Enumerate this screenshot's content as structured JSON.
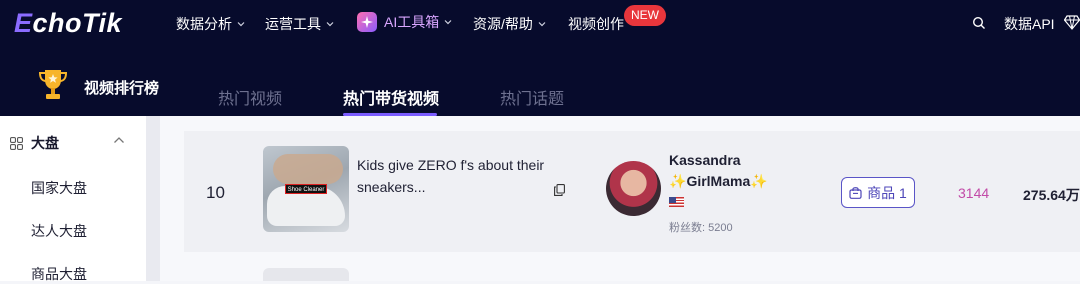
{
  "app": {
    "logo": "EchoTik"
  },
  "nav": {
    "items": [
      {
        "label": "数据分析"
      },
      {
        "label": "运营工具"
      },
      {
        "label": "AI工具箱"
      },
      {
        "label": "资源/帮助"
      },
      {
        "label": "视频创作",
        "badge": "NEW"
      }
    ],
    "data_api": "数据API"
  },
  "ranking": {
    "title": "视频排行榜",
    "tabs": [
      "热门视频",
      "热门带货视频",
      "热门话题"
    ],
    "active_tab": "热门带货视频"
  },
  "sidebar": {
    "section": "大盘",
    "items": [
      "国家大盘",
      "达人大盘",
      "商品大盘"
    ]
  },
  "row": {
    "rank": "10",
    "thumb_label": "Shoe Cleaner",
    "title": "Kids give ZERO f's about their sneakers...",
    "creator_name": "Kassandra",
    "creator_handle": "GirlMama",
    "spark": "✨",
    "followers": "粉丝数: 5200",
    "goods_button": "商品 1",
    "metric_a": "3144",
    "metric_b": "275.64万"
  },
  "colors": {
    "nav_bg": "#070b2c",
    "accent": "#7b5cff",
    "badge": "#e8363c",
    "metric_pink": "#c24ba8"
  }
}
